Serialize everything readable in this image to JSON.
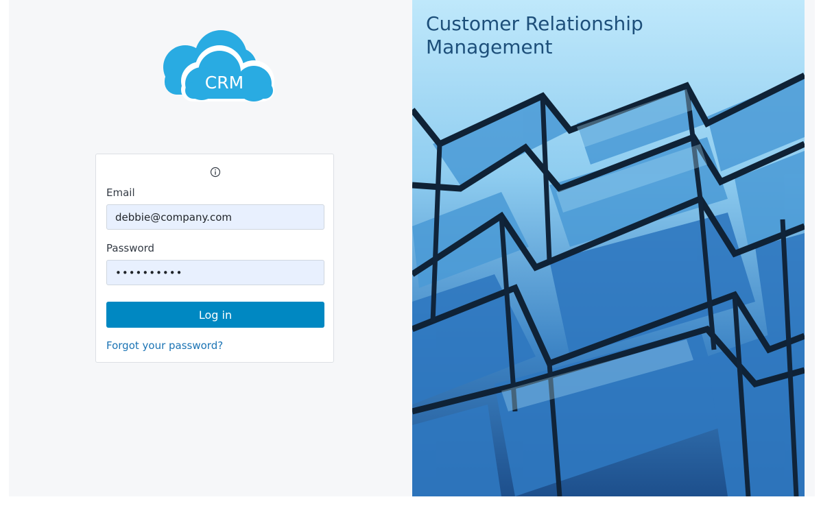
{
  "brand": {
    "logo_text": "CRM",
    "logo_color": "#29abe2",
    "hero_title": "Customer Relationship Management"
  },
  "login_form": {
    "info_icon": "info-circle-icon",
    "email_label": "Email",
    "email_value": "debbie@company.com",
    "password_label": "Password",
    "password_value": "••••••••••",
    "login_button_label": "Log in",
    "forgot_password_link": "Forgot your password?",
    "button_color": "#0088c2",
    "link_color": "#1a73b4"
  }
}
